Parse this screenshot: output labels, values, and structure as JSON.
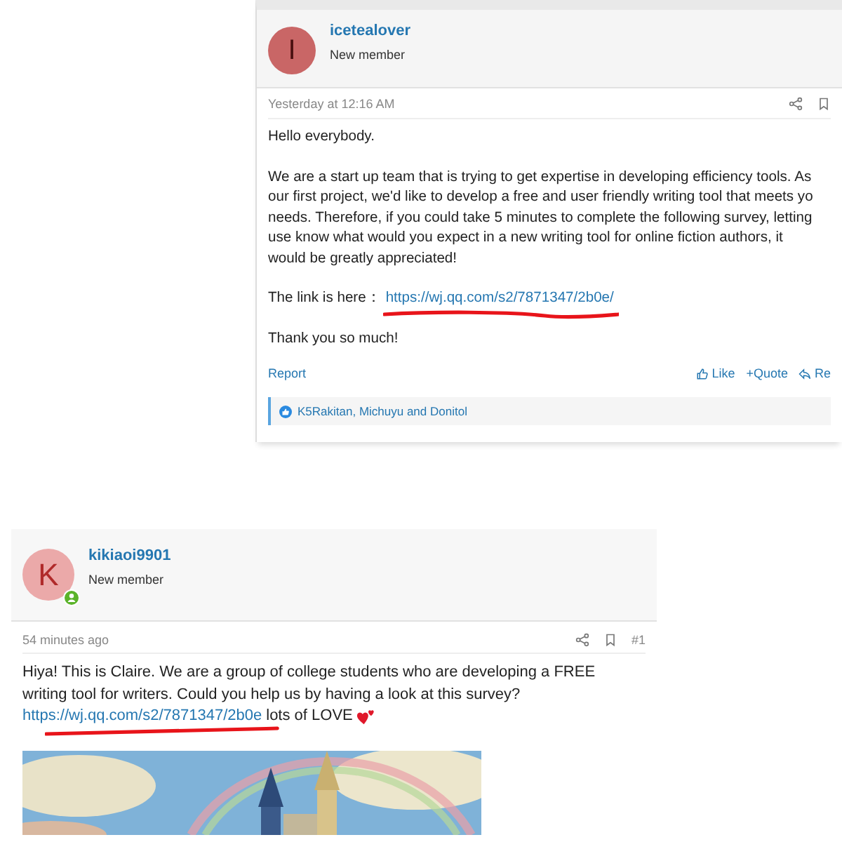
{
  "top_post": {
    "username": "icetealover",
    "avatar_letter": "I",
    "role": "New member",
    "time": "Yesterday at 12:16 AM",
    "greeting": "Hello everybody.",
    "paragraph_lines": [
      "We are a start up team that is trying to get expertise in developing efficiency tools. As",
      "our first project, we'd like to develop a free and user friendly writing tool that meets yo",
      "needs. Therefore, if you could take 5 minutes to complete the following survey, letting",
      "use know what would you expect in a new writing tool for online fiction authors, it",
      "would be greatly appreciated!"
    ],
    "link_label": "The link is here：",
    "link": "https://wj.qq.com/s2/7871347/2b0e/",
    "closing": "Thank you so much!",
    "report": "Report",
    "actions": [
      {
        "kind": "like",
        "label": "Like"
      },
      {
        "kind": "quote",
        "label": "+Quote"
      },
      {
        "kind": "reply",
        "label": "Re"
      }
    ],
    "reactions": "K5Rakitan, Michuyu and Donitol"
  },
  "bottom_post": {
    "username": "kikiaoi9901",
    "avatar_letter": "K",
    "role": "New member",
    "online": true,
    "time": "54 minutes ago",
    "post_number": "#1",
    "intro": "Hiya! This is Claire. We are a group of college students who are developing a FREE writing tool for writers. Could you help us by having a look at this survey?",
    "link": "https://wj.qq.com/s2/7871347/2b0e",
    "after_link": "lots of LOVE"
  }
}
